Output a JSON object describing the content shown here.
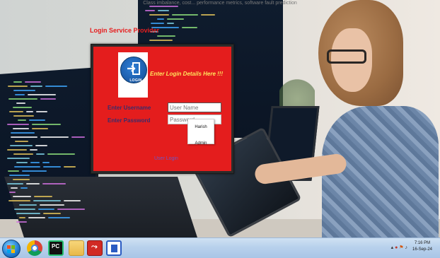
{
  "top_caption": "Class imbalance, cost... performance metrics, software fault prediction",
  "provider_label": "Login Service Provider",
  "login": {
    "logo_text": "LOGIN",
    "heading": "Enter Login Details Here !!!",
    "username_label": "Enter Username",
    "password_label": "Enter Password",
    "username_placeholder": "User Name",
    "password_placeholder": "Password",
    "autocomplete_options": [
      "Harish",
      "Admin"
    ],
    "user_login_link": "User Login"
  },
  "taskbar": {
    "apps": [
      "start-icon",
      "chrome-icon",
      "pycharm-icon",
      "folder-icon",
      "pdf-icon",
      "app-icon"
    ],
    "pycharm_text": "PC",
    "clock_time": "7:16 PM",
    "clock_date": "16-Sep-24"
  }
}
